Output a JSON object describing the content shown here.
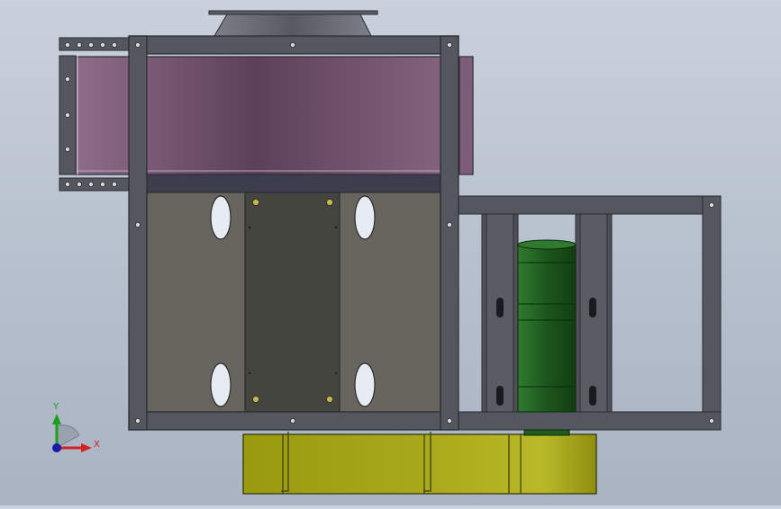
{
  "viewport": {
    "view_name": "Front",
    "background_top": "#c9d1dc",
    "background_bottom": "#a9b3c2"
  },
  "model": {
    "colors": {
      "frame": "#55575e",
      "frame_edge": "#2a2b30",
      "duct": "#7a5a78",
      "duct_light": "#8e6c8a",
      "panel": "#66645e",
      "door": "#46463f",
      "motor": "#1f5c1f",
      "motor_light": "#2f7a2f",
      "base": "#a3a317",
      "base_light": "#c0c02a",
      "hole": "#e6ecf2",
      "bolt": "#d8d8de"
    },
    "parts": [
      "top-flange",
      "inlet-duct",
      "fan-housing",
      "fan-frame",
      "access-door",
      "motor-frame",
      "motor",
      "base-skid"
    ]
  },
  "triad": {
    "y_label": "Y",
    "x_label": "X",
    "y_color": "#1aa01a",
    "x_color": "#d42020",
    "z_color": "#1a1aa8"
  }
}
